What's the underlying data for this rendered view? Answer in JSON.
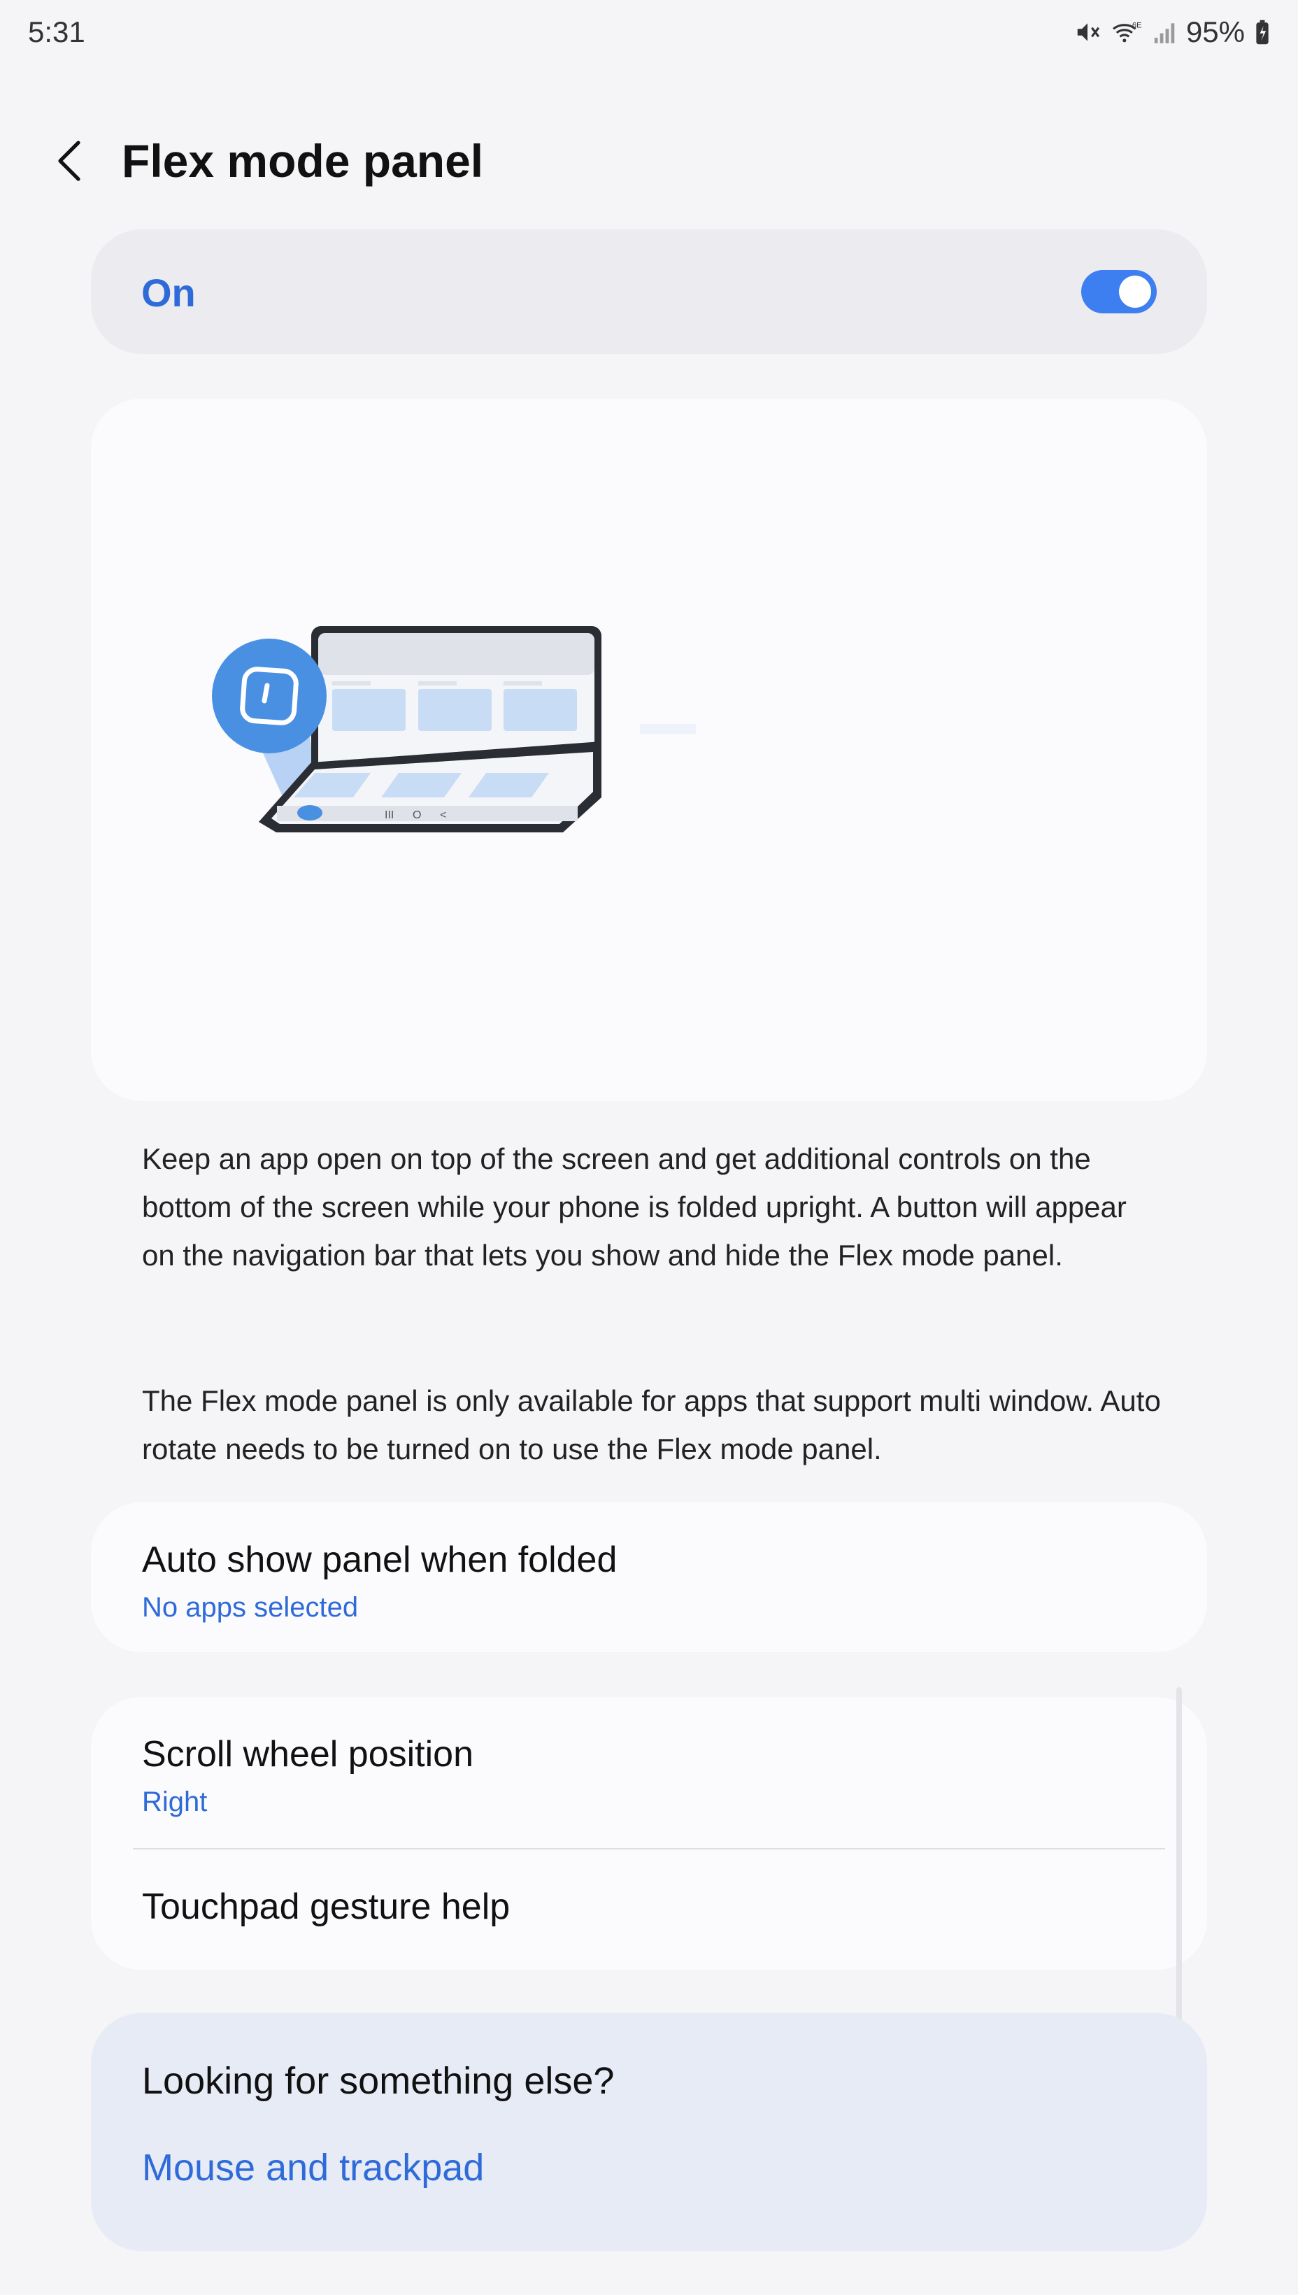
{
  "status_bar": {
    "time": "5:31",
    "battery": "95%",
    "icons": [
      "mute-icon",
      "wifi-6e-icon",
      "signal-icon",
      "battery-charging-icon"
    ]
  },
  "header": {
    "title": "Flex mode panel",
    "back_icon": "back-arrow-icon"
  },
  "master_toggle": {
    "label": "On",
    "state": true,
    "accent": "#3d7ef0"
  },
  "illustration": {
    "icon": "flex-mode-foldable-illustration"
  },
  "description": {
    "paragraph1": "Keep an app open on top of the screen and get additional controls on the bottom of the screen while your phone is folded upright. A button will appear on the navigation bar that lets you show and hide the Flex mode panel.",
    "paragraph2": "The Flex mode panel is only available for apps that support multi window. Auto rotate needs to be turned on to use the Flex mode panel."
  },
  "settings": {
    "auto_show": {
      "title": "Auto show panel when folded",
      "subtitle": "No apps selected"
    },
    "scroll_wheel": {
      "title": "Scroll wheel position",
      "subtitle": "Right"
    },
    "touchpad_help": {
      "title": "Touchpad gesture help"
    }
  },
  "related": {
    "title": "Looking for something else?",
    "link": "Mouse and trackpad"
  }
}
